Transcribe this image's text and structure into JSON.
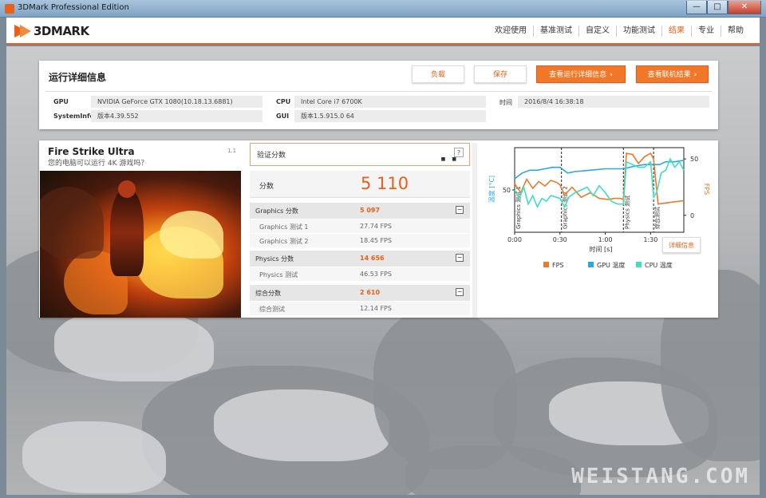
{
  "window": {
    "title": "3DMark Professional Edition",
    "controls": [
      "—",
      "□",
      "✕"
    ]
  },
  "logo": {
    "text": "3DMARK"
  },
  "nav": [
    {
      "label": "欢迎使用",
      "active": false
    },
    {
      "label": "基准测试",
      "active": false
    },
    {
      "label": "自定义",
      "active": false
    },
    {
      "label": "功能测试",
      "active": false
    },
    {
      "label": "结果",
      "active": true
    },
    {
      "label": "专业",
      "active": false
    },
    {
      "label": "帮助",
      "active": false
    }
  ],
  "details": {
    "title": "运行详细信息",
    "buttons": {
      "load": "负载",
      "save": "保存",
      "view_details": "查看运行详细信息",
      "view_online": "查看联机结果"
    },
    "info": {
      "gpu_label": "GPU",
      "gpu_value": "NVIDIA GeForce GTX 1080(10.18.13.6881)",
      "sysinfo_label": "SystemInfo",
      "sysinfo_value": "版本4.39.552",
      "cpu_label": "CPU",
      "cpu_value": "Intel Core i7 6700K",
      "gui_label": "GUI",
      "gui_value": "版本1.5.915.0 64",
      "time_label": "时间",
      "time_value": "2016/8/4 16:38:18"
    }
  },
  "test": {
    "name": "Fire Strike Ultra",
    "subtitle": "您的电脑可以运行 4K 游戏吗？",
    "version": "1.1",
    "verify_label": "验证分数",
    "verify_help": "?",
    "score_label": "分数",
    "score_value": "5 110",
    "sections": [
      {
        "label": "Graphics 分数",
        "value": "5 097",
        "toggle": "−",
        "subs": [
          {
            "label": "Graphics 测试 1",
            "value": "27.74 FPS"
          },
          {
            "label": "Graphics 测试 2",
            "value": "18.45 FPS"
          }
        ]
      },
      {
        "label": "Physics 分数",
        "value": "14 656",
        "toggle": "−",
        "subs": [
          {
            "label": "Physics 测试",
            "value": "46.53 FPS"
          }
        ]
      },
      {
        "label": "综合分数",
        "value": "2 610",
        "toggle": "−",
        "subs": [
          {
            "label": "综合测试",
            "value": "12.14 FPS"
          }
        ]
      }
    ],
    "detail_button": "详细信息"
  },
  "chart_data": {
    "type": "line",
    "xlabel": "时间 [s]",
    "ylabel_left": "温度 [°C]",
    "ylabel_right": "FPS",
    "x_ticks": [
      "0:00",
      "0:30",
      "1:00",
      "1:30"
    ],
    "y_left_ticks": [
      "50"
    ],
    "y_right_ticks": [
      "50",
      "0"
    ],
    "segments": [
      "Graphics 测试 1",
      "Graphics 测试 2",
      "Physics 测试",
      "综合测试"
    ],
    "segment_bounds": [
      0,
      31,
      72,
      92,
      112
    ],
    "xlim": [
      0,
      112
    ],
    "temp_lim": [
      20,
      80
    ],
    "fps_lim": [
      -15,
      60
    ],
    "legend": [
      "FPS",
      "GPU 温度",
      "CPU 温度"
    ],
    "legend_position": "bottom",
    "colors": {
      "fps": "#f07828",
      "gpu": "#2aa8e0",
      "cpu": "#3ee0c0"
    },
    "series": [
      {
        "name": "FPS",
        "axis": "right",
        "color": "#f07828",
        "x": [
          0,
          4,
          8,
          12,
          16,
          20,
          24,
          28,
          30,
          33,
          38,
          44,
          50,
          56,
          62,
          66,
          70,
          72,
          74,
          78,
          82,
          86,
          90,
          92,
          95,
          100,
          106,
          112
        ],
        "y": [
          28,
          20,
          32,
          24,
          30,
          26,
          31,
          29,
          27,
          18,
          25,
          16,
          20,
          15,
          14,
          15,
          15,
          14,
          55,
          54,
          46,
          52,
          55,
          50,
          10,
          11,
          12,
          13
        ]
      },
      {
        "name": "GPU 温度",
        "axis": "left",
        "color": "#2aa8e0",
        "x": [
          0,
          5,
          10,
          15,
          20,
          25,
          30,
          35,
          40,
          50,
          60,
          70,
          72,
          76,
          80,
          86,
          92,
          96,
          100,
          106,
          112
        ],
        "y": [
          58,
          62,
          64,
          64,
          65,
          66,
          66,
          62,
          63,
          64,
          65,
          65,
          65,
          66,
          67,
          68,
          68,
          68,
          70,
          70,
          71
        ]
      },
      {
        "name": "CPU 温度",
        "axis": "left",
        "color": "#3ee0c0",
        "x": [
          0,
          3,
          6,
          9,
          12,
          15,
          18,
          21,
          24,
          27,
          30,
          33,
          36,
          40,
          44,
          48,
          52,
          56,
          60,
          64,
          68,
          72,
          74,
          78,
          82,
          86,
          90,
          92,
          94,
          97,
          100,
          103,
          106,
          109,
          112
        ],
        "y": [
          50,
          44,
          52,
          40,
          46,
          38,
          44,
          42,
          46,
          45,
          44,
          38,
          45,
          48,
          50,
          52,
          46,
          53,
          48,
          42,
          40,
          40,
          70,
          68,
          66,
          66,
          70,
          45,
          48,
          62,
          64,
          72,
          66,
          70,
          64
        ]
      }
    ]
  }
}
